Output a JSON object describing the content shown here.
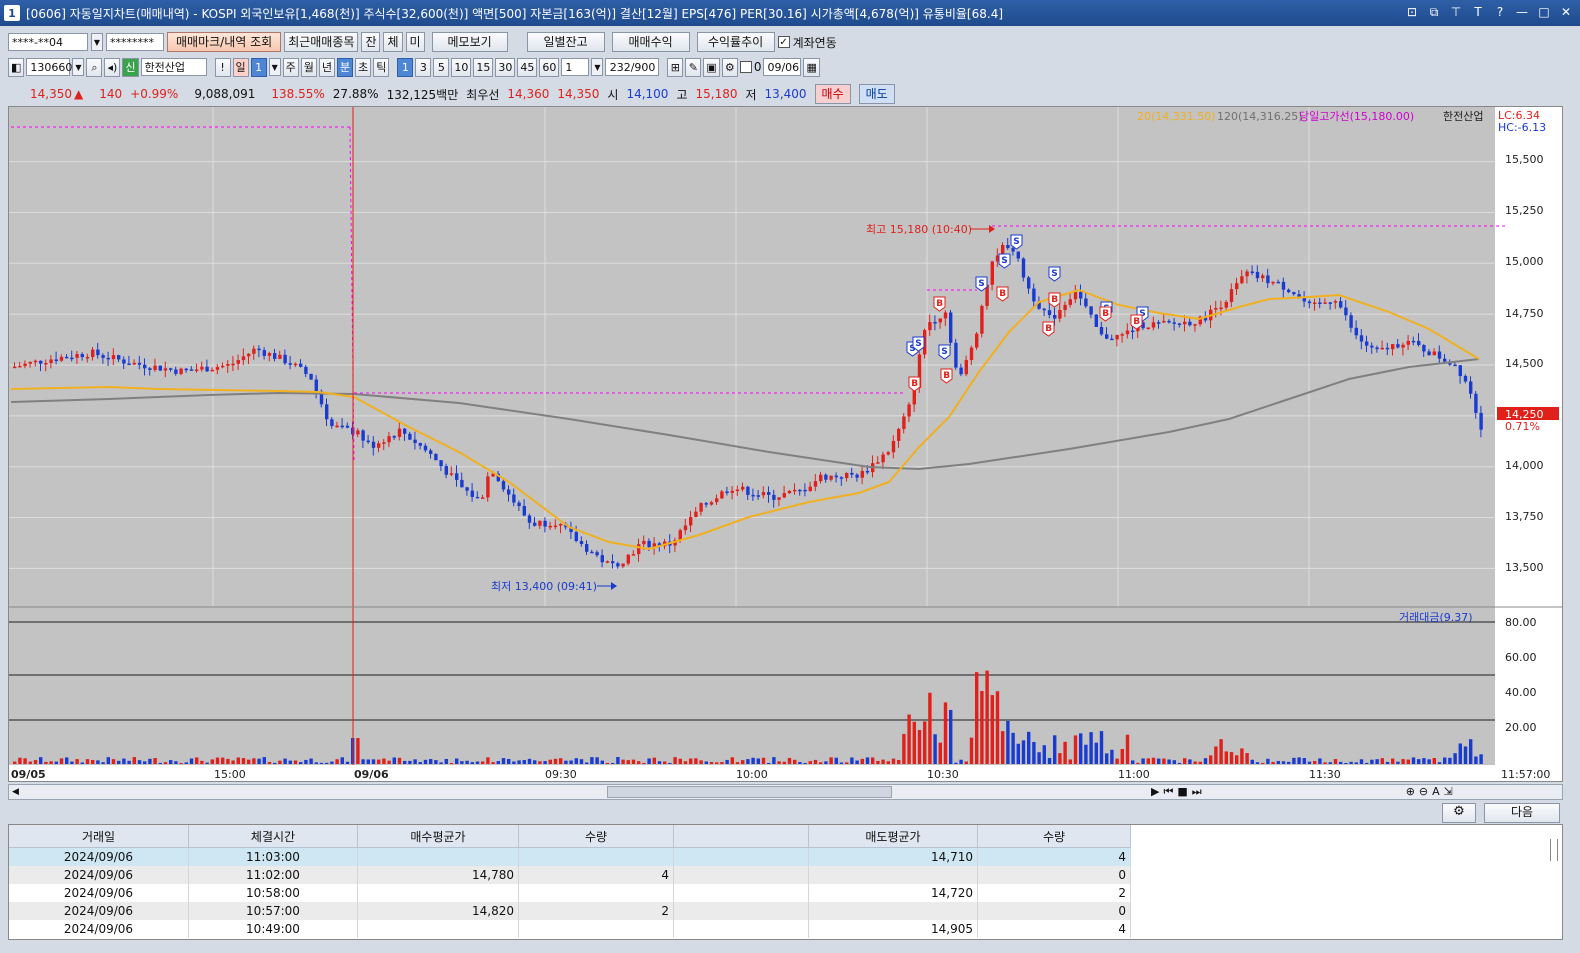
{
  "window": {
    "num": "1",
    "title": "[0606] 자동일지차트(매매내역) - KOSPI 외국인보유[1,468(천)] 주식수[32,600(천)] 액면[500] 자본금[163(억)] 결산[12월] EPS[476] PER[30.16] 시가총액[4,678(억)] 유통비율[68.4]",
    "controls": [
      "⊡",
      "⧉",
      "⊤",
      "T",
      "?",
      "—",
      "□",
      "✕"
    ]
  },
  "toolbar1": {
    "account": "****-**04",
    "password": "********",
    "buttons": [
      "매매마크/내역 조회",
      "최근매매종목",
      "잔",
      "체",
      "미",
      "메모보기",
      "일별잔고",
      "매매수익",
      "수익률추이"
    ],
    "link_label": "계좌연동",
    "link_checked": "✓"
  },
  "toolbar2": {
    "code": "130660",
    "badge": "신",
    "stock_name": "한전산업",
    "exclaim": "!",
    "period_day": "일",
    "period_num": "1",
    "periods": [
      "주",
      "월",
      "년"
    ],
    "period_min": "분",
    "periods2": [
      "초",
      "틱"
    ],
    "intervals": [
      "1",
      "3",
      "5",
      "10",
      "15",
      "30",
      "45",
      "60"
    ],
    "interval_sel": "1",
    "count_sel": "1",
    "count": "232/900",
    "date_chk_label": "0",
    "date": "09/06"
  },
  "quote": {
    "price": "14,350",
    "arrow": "▲",
    "change": "140",
    "pct": "+0.99%",
    "volume": "9,088,091",
    "vol_ratio": "138.55%",
    "turnover": "27.88%",
    "amount": "132,125백만",
    "bid_label": "최우선",
    "ask_price": "14,360",
    "bid_price": "14,350",
    "open_label": "시",
    "open": "14,100",
    "high_label": "고",
    "high": "15,180",
    "low_label": "저",
    "low": "13,400",
    "buy_btn": "매수",
    "sell_btn": "매도"
  },
  "chart": {
    "legend": {
      "ma20": "20(14,331.50)",
      "ma120": "120(14,316.25)",
      "dayhigh": "당일고가선(15,180.00)",
      "name": "한전산업",
      "lc": "LC:6.34",
      "hc": "HC:-6.13"
    },
    "price_ticks": [
      "15,500",
      "15,250",
      "15,000",
      "14,750",
      "14,500",
      "14,250",
      "14,000",
      "13,750",
      "13,500"
    ],
    "current_price": "14,250",
    "current_pct": "0.71%",
    "high_annot": "최고 15,180 (10:40)",
    "low_annot": "최저 13,400 (09:41)",
    "volume_legend": "거래대금(9.37)",
    "volume_ticks": [
      "80.00",
      "60.00",
      "40.00",
      "20.00"
    ],
    "time_labels": [
      "09/05",
      "15:00",
      "09/06",
      "09:30",
      "10:00",
      "10:30",
      "11:00",
      "11:30"
    ],
    "end_time": "11:57:00",
    "colors": {
      "up": "#e0211b",
      "down": "#1a3bd0",
      "ma20": "#f0b020",
      "ma120": "#808080",
      "dayhigh": "#ff00ff"
    }
  },
  "chart_data": {
    "type": "candlestick",
    "y_range": [
      13400,
      15180
    ],
    "ma20_last": 14331.5,
    "ma120_last": 14316.25,
    "day_high": 15180,
    "day_low": 13400
  },
  "scroll": {
    "left_arrow": "◀",
    "right_arrow": "▶",
    "tools": [
      "⏮",
      "■",
      "⏭",
      "⊕",
      "⊖",
      "A",
      "⇲"
    ]
  },
  "nav": {
    "gear": "⚙",
    "next": "다음"
  },
  "table": {
    "headers": [
      "거래일",
      "체결시간",
      "매수평균가",
      "수량",
      "",
      "매도평균가",
      "수량"
    ],
    "rows": [
      [
        "2024/09/06",
        "11:03:00",
        "",
        "",
        "",
        "14,710",
        "4"
      ],
      [
        "2024/09/06",
        "11:02:00",
        "14,780",
        "4",
        "",
        "",
        "0"
      ],
      [
        "2024/09/06",
        "10:58:00",
        "",
        "",
        "",
        "14,720",
        "2"
      ],
      [
        "2024/09/06",
        "10:57:00",
        "14,820",
        "2",
        "",
        "",
        "0"
      ],
      [
        "2024/09/06",
        "10:49:00",
        "",
        "",
        "",
        "14,905",
        "4"
      ]
    ]
  }
}
